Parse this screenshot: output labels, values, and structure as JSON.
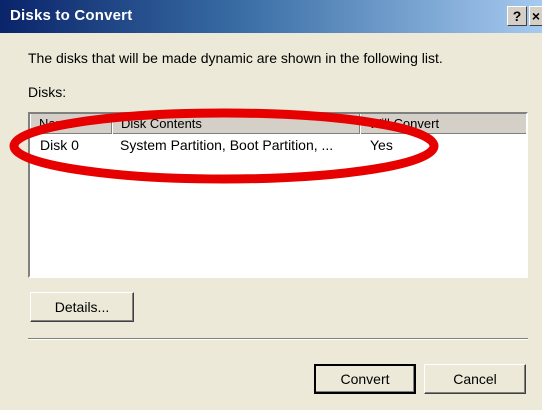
{
  "window": {
    "title": "Disks to Convert",
    "help_label": "?",
    "close_label": "×"
  },
  "main": {
    "description": "The disks that will be made dynamic are shown in the following list.",
    "disks_label": "Disks:",
    "columns": [
      "Name",
      "Disk Contents",
      "Will Convert"
    ],
    "rows": [
      {
        "name": "Disk 0",
        "contents": "System Partition, Boot Partition, ...",
        "convert": "Yes"
      }
    ]
  },
  "buttons": {
    "details": "Details...",
    "convert": "Convert",
    "cancel": "Cancel"
  },
  "colors": {
    "title_bar": "#0a246a",
    "highlight": "#e60000"
  }
}
